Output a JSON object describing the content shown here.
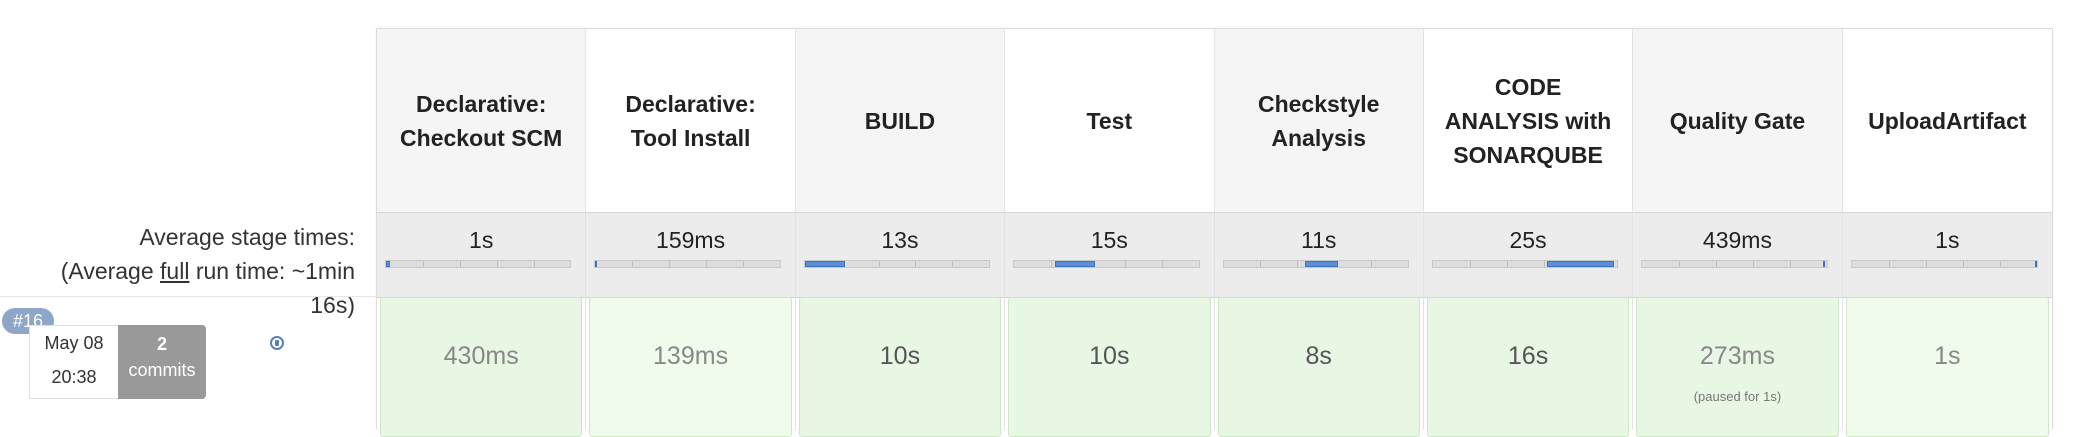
{
  "summary": {
    "line1": "Average stage times:",
    "line2_prefix": "(Average ",
    "line2_link": "full",
    "line2_suffix": " run time: ~1min",
    "line3": "16s)"
  },
  "build": {
    "number": "#16",
    "date": "May 08",
    "time": "20:38",
    "commits_count": "2",
    "commits_label": "commits"
  },
  "stages": [
    {
      "name": "Declarative: Checkout SCM",
      "avg": "1s",
      "avg_bar": {
        "start": 0.0,
        "end": 0.02
      },
      "run": "430ms",
      "note": ""
    },
    {
      "name": "Declarative: Tool Install",
      "avg": "159ms",
      "avg_bar": {
        "start": 0.0,
        "end": 0.01
      },
      "run": "139ms",
      "note": ""
    },
    {
      "name": "BUILD",
      "avg": "13s",
      "avg_bar": {
        "start": 0.0,
        "end": 0.22
      },
      "run": "10s",
      "note": ""
    },
    {
      "name": "Test",
      "avg": "15s",
      "avg_bar": {
        "start": 0.22,
        "end": 0.44
      },
      "run": "10s",
      "note": ""
    },
    {
      "name": "Checkstyle Analysis",
      "avg": "11s",
      "avg_bar": {
        "start": 0.44,
        "end": 0.62
      },
      "run": "8s",
      "note": ""
    },
    {
      "name": "CODE ANALYSIS with SONARQUBE",
      "avg": "25s",
      "avg_bar": {
        "start": 0.62,
        "end": 0.98
      },
      "run": "16s",
      "note": ""
    },
    {
      "name": "Quality Gate",
      "avg": "439ms",
      "avg_bar": {
        "start": 0.98,
        "end": 0.99
      },
      "run": "273ms",
      "note": "(paused for 1s)"
    },
    {
      "name": "UploadArtifact",
      "avg": "1s",
      "avg_bar": {
        "start": 0.99,
        "end": 1.0
      },
      "run": "1s",
      "note": ""
    }
  ],
  "colors": {
    "bar_fill": "#5b8fd6",
    "success_cell": "#e8f6e4",
    "badge": "#8ea6c8"
  }
}
